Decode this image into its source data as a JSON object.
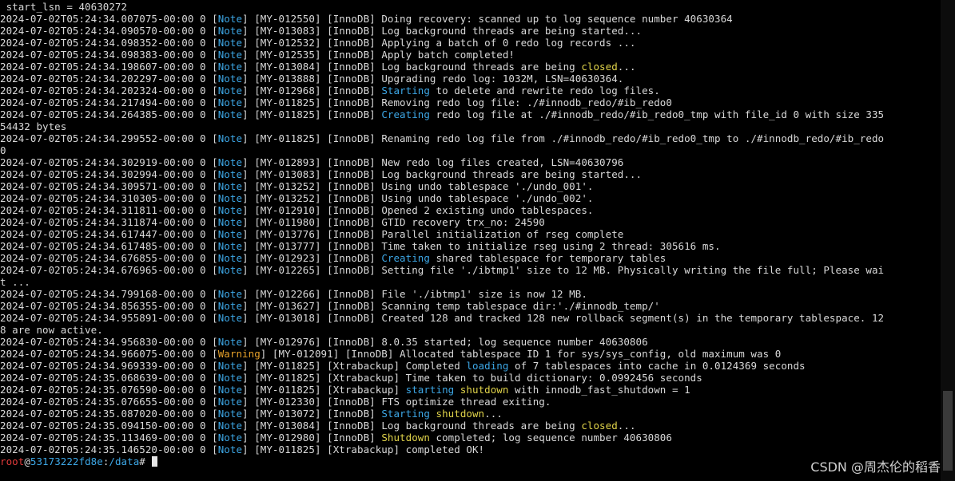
{
  "terminal": {
    "first_line": " start_lsn = 40630272",
    "lines": [
      {
        "ts": "2024-07-02T05:24:34.007075-00:00 0 ",
        "level": "Note",
        "code": "MY-012550",
        "comp": "InnoDB",
        "pre": "Doing recovery: scanned up to log sequence number 40630364",
        "hl": "",
        "hl_color": "",
        "post": ""
      },
      {
        "ts": "2024-07-02T05:24:34.090570-00:00 0 ",
        "level": "Note",
        "code": "MY-013083",
        "comp": "InnoDB",
        "pre": "Log background threads are being started...",
        "hl": "",
        "hl_color": "",
        "post": ""
      },
      {
        "ts": "2024-07-02T05:24:34.098352-00:00 0 ",
        "level": "Note",
        "code": "MY-012532",
        "comp": "InnoDB",
        "pre": "Applying a batch of 0 redo log records ...",
        "hl": "",
        "hl_color": "",
        "post": ""
      },
      {
        "ts": "2024-07-02T05:24:34.098383-00:00 0 ",
        "level": "Note",
        "code": "MY-012535",
        "comp": "InnoDB",
        "pre": "Apply batch completed!",
        "hl": "",
        "hl_color": "",
        "post": ""
      },
      {
        "ts": "2024-07-02T05:24:34.198607-00:00 0 ",
        "level": "Note",
        "code": "MY-013084",
        "comp": "InnoDB",
        "pre": "Log background threads are being ",
        "hl": "closed",
        "hl_color": "yellow",
        "post": "..."
      },
      {
        "ts": "2024-07-02T05:24:34.202297-00:00 0 ",
        "level": "Note",
        "code": "MY-013888",
        "comp": "InnoDB",
        "pre": "Upgrading redo log: 1032M, LSN=40630364.",
        "hl": "",
        "hl_color": "",
        "post": ""
      },
      {
        "ts": "2024-07-02T05:24:34.202324-00:00 0 ",
        "level": "Note",
        "code": "MY-012968",
        "comp": "InnoDB",
        "pre": "",
        "hl": "Starting",
        "hl_color": "blue",
        "post": " to delete and rewrite redo log files."
      },
      {
        "ts": "2024-07-02T05:24:34.217494-00:00 0 ",
        "level": "Note",
        "code": "MY-011825",
        "comp": "InnoDB",
        "pre": "Removing redo log file: ./#innodb_redo/#ib_redo0",
        "hl": "",
        "hl_color": "",
        "post": ""
      },
      {
        "ts": "2024-07-02T05:24:34.264385-00:00 0 ",
        "level": "Note",
        "code": "MY-011825",
        "comp": "InnoDB",
        "pre": "",
        "hl": "Creating",
        "hl_color": "blue",
        "post": " redo log file at ./#innodb_redo/#ib_redo0_tmp with file_id 0 with size 335"
      },
      {
        "raw": "54432 bytes"
      },
      {
        "ts": "2024-07-02T05:24:34.299552-00:00 0 ",
        "level": "Note",
        "code": "MY-011825",
        "comp": "InnoDB",
        "pre": "Renaming redo log file from ./#innodb_redo/#ib_redo0_tmp to ./#innodb_redo/#ib_redo",
        "hl": "",
        "hl_color": "",
        "post": ""
      },
      {
        "raw": "0"
      },
      {
        "ts": "2024-07-02T05:24:34.302919-00:00 0 ",
        "level": "Note",
        "code": "MY-012893",
        "comp": "InnoDB",
        "pre": "New redo log files created, LSN=40630796",
        "hl": "",
        "hl_color": "",
        "post": ""
      },
      {
        "ts": "2024-07-02T05:24:34.302994-00:00 0 ",
        "level": "Note",
        "code": "MY-013083",
        "comp": "InnoDB",
        "pre": "Log background threads are being started...",
        "hl": "",
        "hl_color": "",
        "post": ""
      },
      {
        "ts": "2024-07-02T05:24:34.309571-00:00 0 ",
        "level": "Note",
        "code": "MY-013252",
        "comp": "InnoDB",
        "pre": "Using undo tablespace './undo_001'.",
        "hl": "",
        "hl_color": "",
        "post": ""
      },
      {
        "ts": "2024-07-02T05:24:34.310305-00:00 0 ",
        "level": "Note",
        "code": "MY-013252",
        "comp": "InnoDB",
        "pre": "Using undo tablespace './undo_002'.",
        "hl": "",
        "hl_color": "",
        "post": ""
      },
      {
        "ts": "2024-07-02T05:24:34.311811-00:00 0 ",
        "level": "Note",
        "code": "MY-012910",
        "comp": "InnoDB",
        "pre": "Opened 2 existing undo tablespaces.",
        "hl": "",
        "hl_color": "",
        "post": ""
      },
      {
        "ts": "2024-07-02T05:24:34.311874-00:00 0 ",
        "level": "Note",
        "code": "MY-011980",
        "comp": "InnoDB",
        "pre": "GTID recovery trx_no: 24590",
        "hl": "",
        "hl_color": "",
        "post": ""
      },
      {
        "ts": "2024-07-02T05:24:34.617447-00:00 0 ",
        "level": "Note",
        "code": "MY-013776",
        "comp": "InnoDB",
        "pre": "Parallel initialization of rseg complete",
        "hl": "",
        "hl_color": "",
        "post": ""
      },
      {
        "ts": "2024-07-02T05:24:34.617485-00:00 0 ",
        "level": "Note",
        "code": "MY-013777",
        "comp": "InnoDB",
        "pre": "Time taken to initialize rseg using 2 thread: 305616 ms.",
        "hl": "",
        "hl_color": "",
        "post": ""
      },
      {
        "ts": "2024-07-02T05:24:34.676855-00:00 0 ",
        "level": "Note",
        "code": "MY-012923",
        "comp": "InnoDB",
        "pre": "",
        "hl": "Creating",
        "hl_color": "blue",
        "post": " shared tablespace for temporary tables"
      },
      {
        "ts": "2024-07-02T05:24:34.676965-00:00 0 ",
        "level": "Note",
        "code": "MY-012265",
        "comp": "InnoDB",
        "pre": "Setting file './ibtmp1' size to 12 MB. Physically writing the file full; Please wai",
        "hl": "",
        "hl_color": "",
        "post": ""
      },
      {
        "raw": "t ..."
      },
      {
        "ts": "2024-07-02T05:24:34.799168-00:00 0 ",
        "level": "Note",
        "code": "MY-012266",
        "comp": "InnoDB",
        "pre": "File './ibtmp1' size is now 12 MB.",
        "hl": "",
        "hl_color": "",
        "post": ""
      },
      {
        "ts": "2024-07-02T05:24:34.856355-00:00 0 ",
        "level": "Note",
        "code": "MY-013627",
        "comp": "InnoDB",
        "pre": "Scanning temp tablespace dir:'./#innodb_temp/'",
        "hl": "",
        "hl_color": "",
        "post": ""
      },
      {
        "ts": "2024-07-02T05:24:34.955891-00:00 0 ",
        "level": "Note",
        "code": "MY-013018",
        "comp": "InnoDB",
        "pre": "Created 128 and tracked 128 new rollback segment(s) in the temporary tablespace. 12",
        "hl": "",
        "hl_color": "",
        "post": ""
      },
      {
        "raw": "8 are now active."
      },
      {
        "ts": "2024-07-02T05:24:34.956830-00:00 0 ",
        "level": "Note",
        "code": "MY-012976",
        "comp": "InnoDB",
        "pre": "8.0.35 started; log sequence number 40630806",
        "hl": "",
        "hl_color": "",
        "post": ""
      },
      {
        "ts": "2024-07-02T05:24:34.966075-00:00 0 ",
        "level": "Warning",
        "code": "MY-012091",
        "comp": "InnoDB",
        "pre": "Allocated tablespace ID 1 for sys/sys_config, old maximum was 0",
        "hl": "",
        "hl_color": "",
        "post": ""
      },
      {
        "ts": "2024-07-02T05:24:34.969339-00:00 0 ",
        "level": "Note",
        "code": "MY-011825",
        "comp": "Xtrabackup",
        "pre": "Completed ",
        "hl": "loading",
        "hl_color": "blue",
        "post": " of 7 tablespaces into cache in 0.0124369 seconds"
      },
      {
        "ts": "2024-07-02T05:24:35.068639-00:00 0 ",
        "level": "Note",
        "code": "MY-011825",
        "comp": "Xtrabackup",
        "pre": "Time taken to build dictionary: 0.0992456 seconds",
        "hl": "",
        "hl_color": "",
        "post": ""
      },
      {
        "ts": "2024-07-02T05:24:35.076590-00:00 0 ",
        "level": "Note",
        "code": "MY-011825",
        "comp": "Xtrabackup",
        "pre": "",
        "hl": "starting",
        "hl_color": "blue",
        "hl2": " shutdown",
        "hl2_color": "yellow",
        "post": " with innodb_fast_shutdown = 1"
      },
      {
        "ts": "2024-07-02T05:24:35.076655-00:00 0 ",
        "level": "Note",
        "code": "MY-012330",
        "comp": "InnoDB",
        "pre": "FTS optimize thread exiting.",
        "hl": "",
        "hl_color": "",
        "post": ""
      },
      {
        "ts": "2024-07-02T05:24:35.087020-00:00 0 ",
        "level": "Note",
        "code": "MY-013072",
        "comp": "InnoDB",
        "pre": "",
        "hl": "Starting",
        "hl_color": "blue",
        "hl2": " shutdown",
        "hl2_color": "yellow",
        "post": "..."
      },
      {
        "ts": "2024-07-02T05:24:35.094150-00:00 0 ",
        "level": "Note",
        "code": "MY-013084",
        "comp": "InnoDB",
        "pre": "Log background threads are being ",
        "hl": "closed",
        "hl_color": "yellow",
        "post": "..."
      },
      {
        "ts": "2024-07-02T05:24:35.113469-00:00 0 ",
        "level": "Note",
        "code": "MY-012980",
        "comp": "InnoDB",
        "pre": "",
        "hl": "Shutdown",
        "hl_color": "yellow",
        "post": " completed; log sequence number 40630806"
      },
      {
        "ts": "2024-07-02T05:24:35.146520-00:00 0 ",
        "level": "Note",
        "code": "MY-011825",
        "comp": "Xtrabackup",
        "pre": "completed OK!",
        "hl": "",
        "hl_color": "",
        "post": ""
      }
    ],
    "prompt": {
      "user": "root",
      "at": "@",
      "host": "53173222fd8e",
      "sep": ":",
      "path": "/data",
      "symbol": "# "
    }
  },
  "watermark": "CSDN @周杰伦的稻香",
  "colors": {
    "background": "#000000",
    "text": "#d9d9d9",
    "note": "#3da7e6",
    "warning": "#e6a12a",
    "highlight_blue": "#3da7e6",
    "highlight_yellow": "#e0d34a",
    "prompt_user": "#e03a3a"
  }
}
